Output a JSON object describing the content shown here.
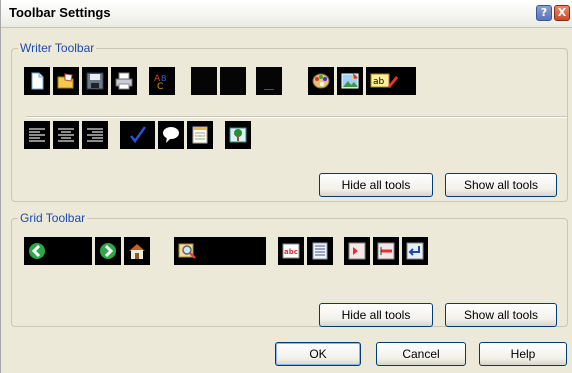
{
  "window": {
    "title": "Toolbar Settings"
  },
  "title_buttons": {
    "help": "?",
    "close": "X"
  },
  "writer_toolbar": {
    "legend": "Writer Toolbar",
    "row1": [
      "new-document-icon",
      "open-folder-icon",
      "save-disk-icon",
      "print-icon",
      "spell-check-icon",
      "blank-slot",
      "blank-slot",
      "blank-slot",
      "color-palette-icon",
      "picture-icon",
      "text-style-icon"
    ],
    "row2": [
      "align-left-icon",
      "align-center-icon",
      "align-right-icon",
      "check-mark-icon",
      "speech-bubble-icon",
      "notepad-icon",
      "tree-picture-icon"
    ],
    "hide_all": "Hide all tools",
    "show_all": "Show all tools"
  },
  "grid_toolbar": {
    "legend": "Grid Toolbar",
    "row1": [
      "back-arrow-icon",
      "forward-arrow-icon",
      "home-icon",
      "search-icon",
      "abc-icon",
      "list-icon",
      "insert-row-icon",
      "delete-row-icon",
      "enter-icon"
    ],
    "hide_all": "Hide all tools",
    "show_all": "Show all tools"
  },
  "footer": {
    "ok": "OK",
    "cancel": "Cancel",
    "help": "Help"
  },
  "colors": {
    "legend_text": "#1f4aa8",
    "dialog_bg": "#ece9d8",
    "icon_slot_bg": "#000000"
  }
}
